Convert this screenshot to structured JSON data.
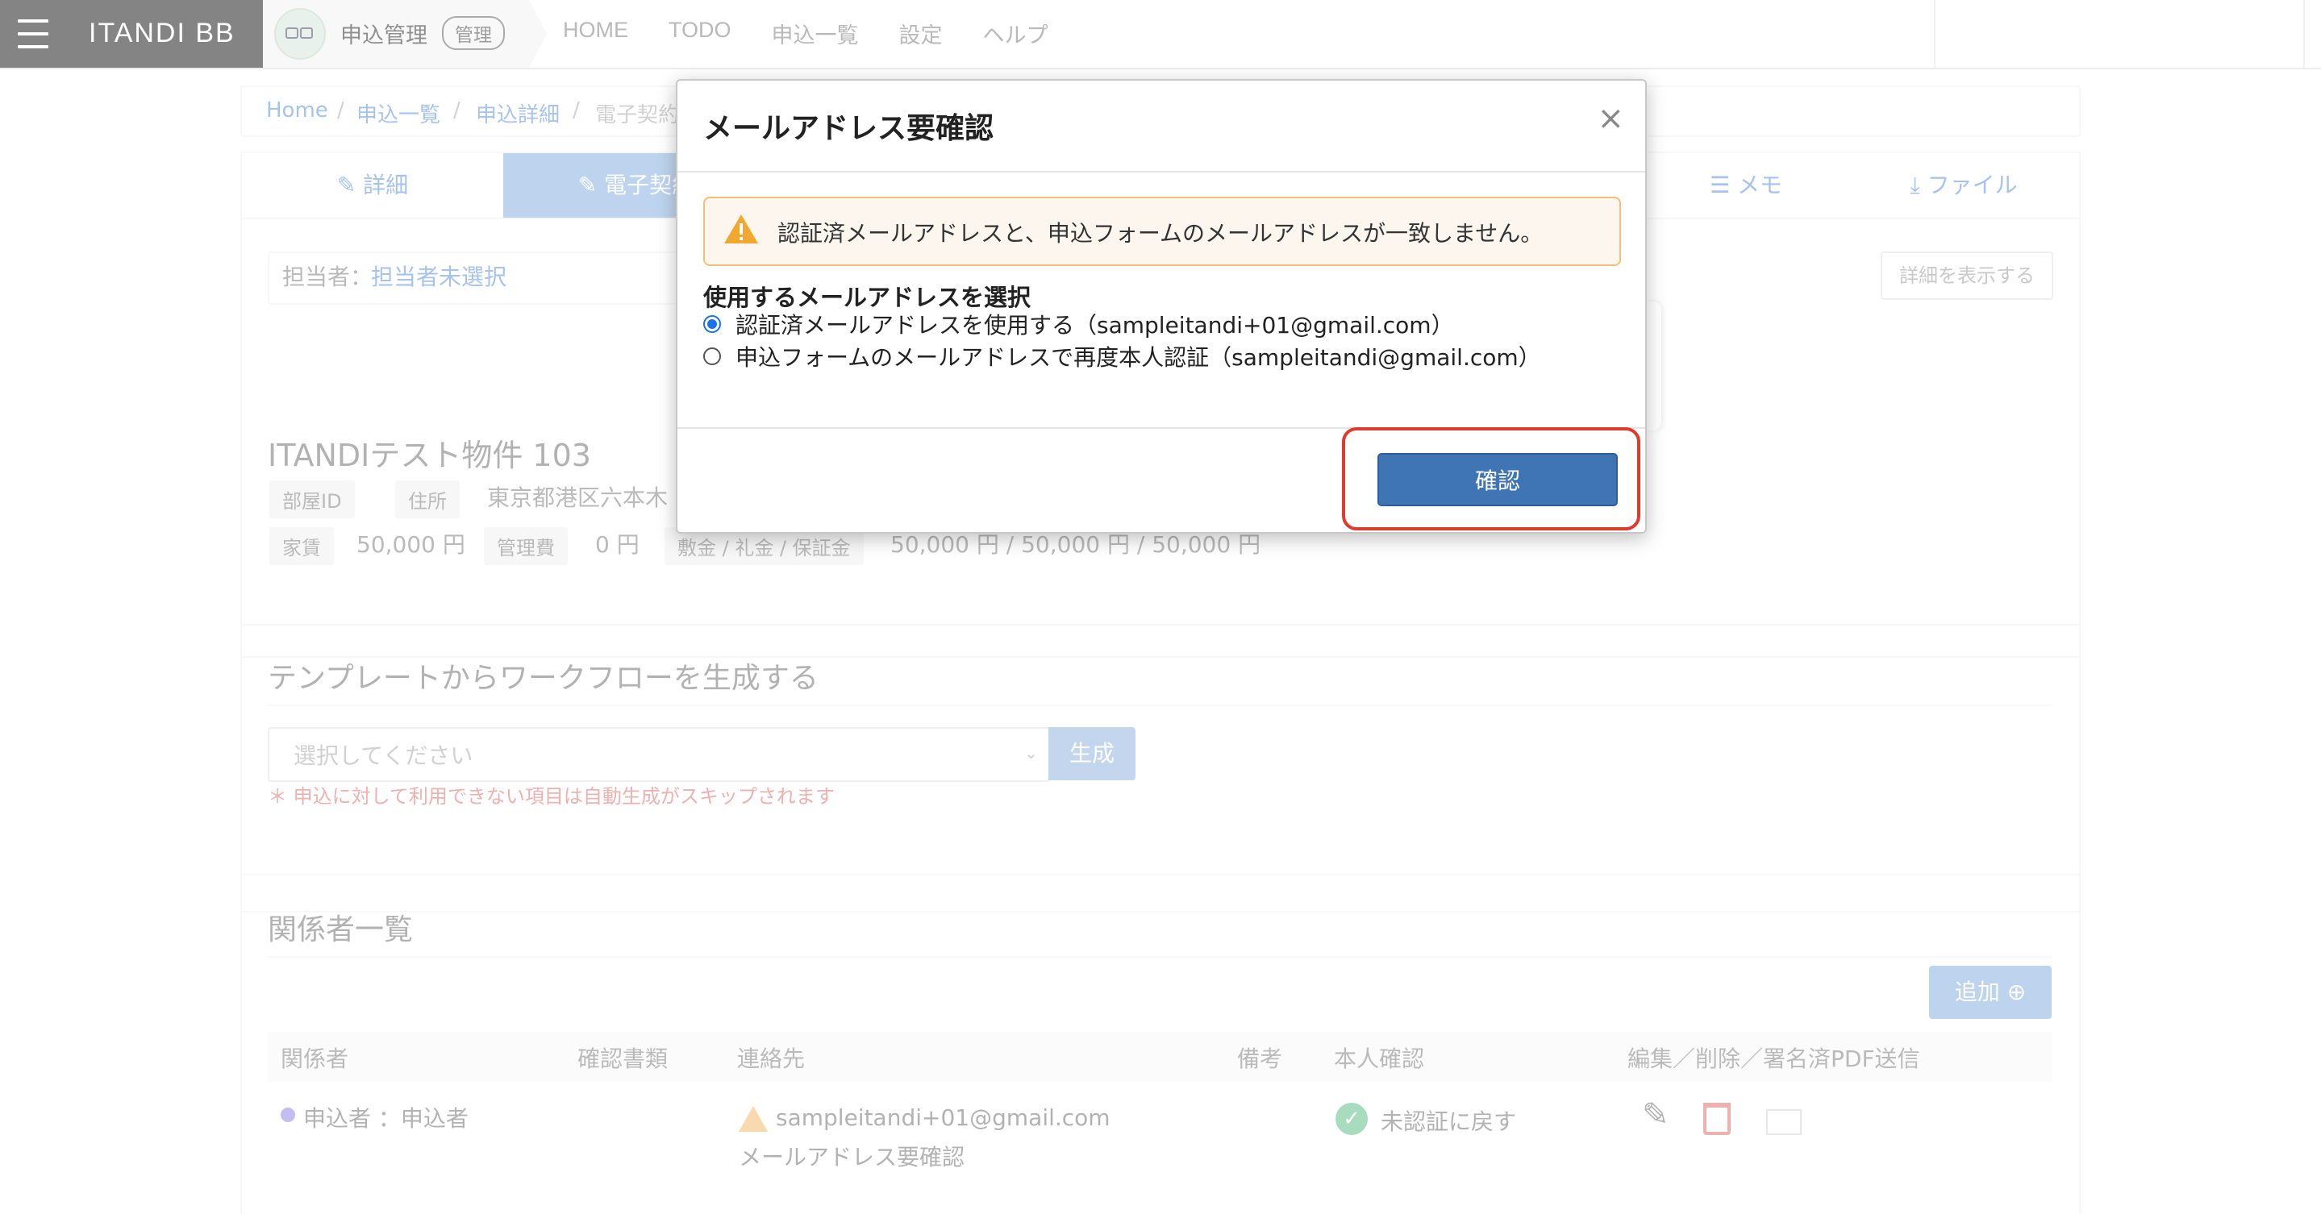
{
  "topbar": {
    "brand": "ITANDI BB",
    "app_name": "申込管理",
    "app_badge": "管理",
    "nav": [
      "HOME",
      "TODO",
      "申込一覧",
      "設定",
      "ヘルプ"
    ]
  },
  "breadcrumb": [
    "Home",
    "申込一覧",
    "申込詳細",
    "電子契約"
  ],
  "tabs": [
    "詳細",
    "電子契約",
    "メモ",
    "ファイル"
  ],
  "assignee": {
    "label": "担当者：",
    "value": "担当者未選択",
    "details_button": "詳細を表示する"
  },
  "property": {
    "title": "ITANDIテスト物件 103",
    "room_id_label": "部屋ID",
    "address_label": "住所",
    "address_value": "東京都港区六本木",
    "rent_label": "家賃",
    "rent_value": "50,000 円",
    "fee_label": "管理費",
    "fee_value": "0 円",
    "deposit_label": "敷金 / 礼金 / 保証金",
    "deposit_value": "50,000 円 / 50,000 円 / 50,000 円"
  },
  "workflow": {
    "title": "テンプレートからワークフローを生成する",
    "select_placeholder": "選択してください",
    "generate_button": "生成",
    "note": "＊ 申込に対して利用できない項目は自動生成がスキップされます"
  },
  "parties": {
    "title": "関係者一覧",
    "add_button": "追加",
    "columns": [
      "関係者",
      "確認書類",
      "連絡先",
      "備考",
      "本人確認",
      "編集／削除／署名済PDF送信"
    ],
    "rows": [
      {
        "party": "申込者 ：申込者",
        "email": "sampleitandi+01@gmail.com",
        "email_status": "メールアドレス要確認",
        "verification": "未認証に戻す"
      }
    ]
  },
  "modal": {
    "title": "メールアドレス要確認",
    "close": "×",
    "alert_text": "認証済メールアドレスと、申込フォームのメールアドレスが一致しません。",
    "choose_label": "使用するメールアドレスを選択",
    "options": [
      {
        "label": "認証済メールアドレスを使用する（sampleitandi+01@gmail.com）",
        "checked": true
      },
      {
        "label": "申込フォームのメールアドレスで再度本人認証（sampleitandi@gmail.com）",
        "checked": false
      }
    ],
    "confirm_button": "確認"
  },
  "colors": {
    "primary": "#3f74b5",
    "highlight": "#e03a2f",
    "warning": "#f0ad4e",
    "brand_bg": "#6a6a6a"
  },
  "icons": {
    "menu": "hamburger-icon",
    "warning": "warning-triangle-icon",
    "close": "close-icon",
    "edit": "pencil-icon",
    "delete": "trash-icon",
    "mail": "mail-icon",
    "verified": "check-circle-icon"
  }
}
